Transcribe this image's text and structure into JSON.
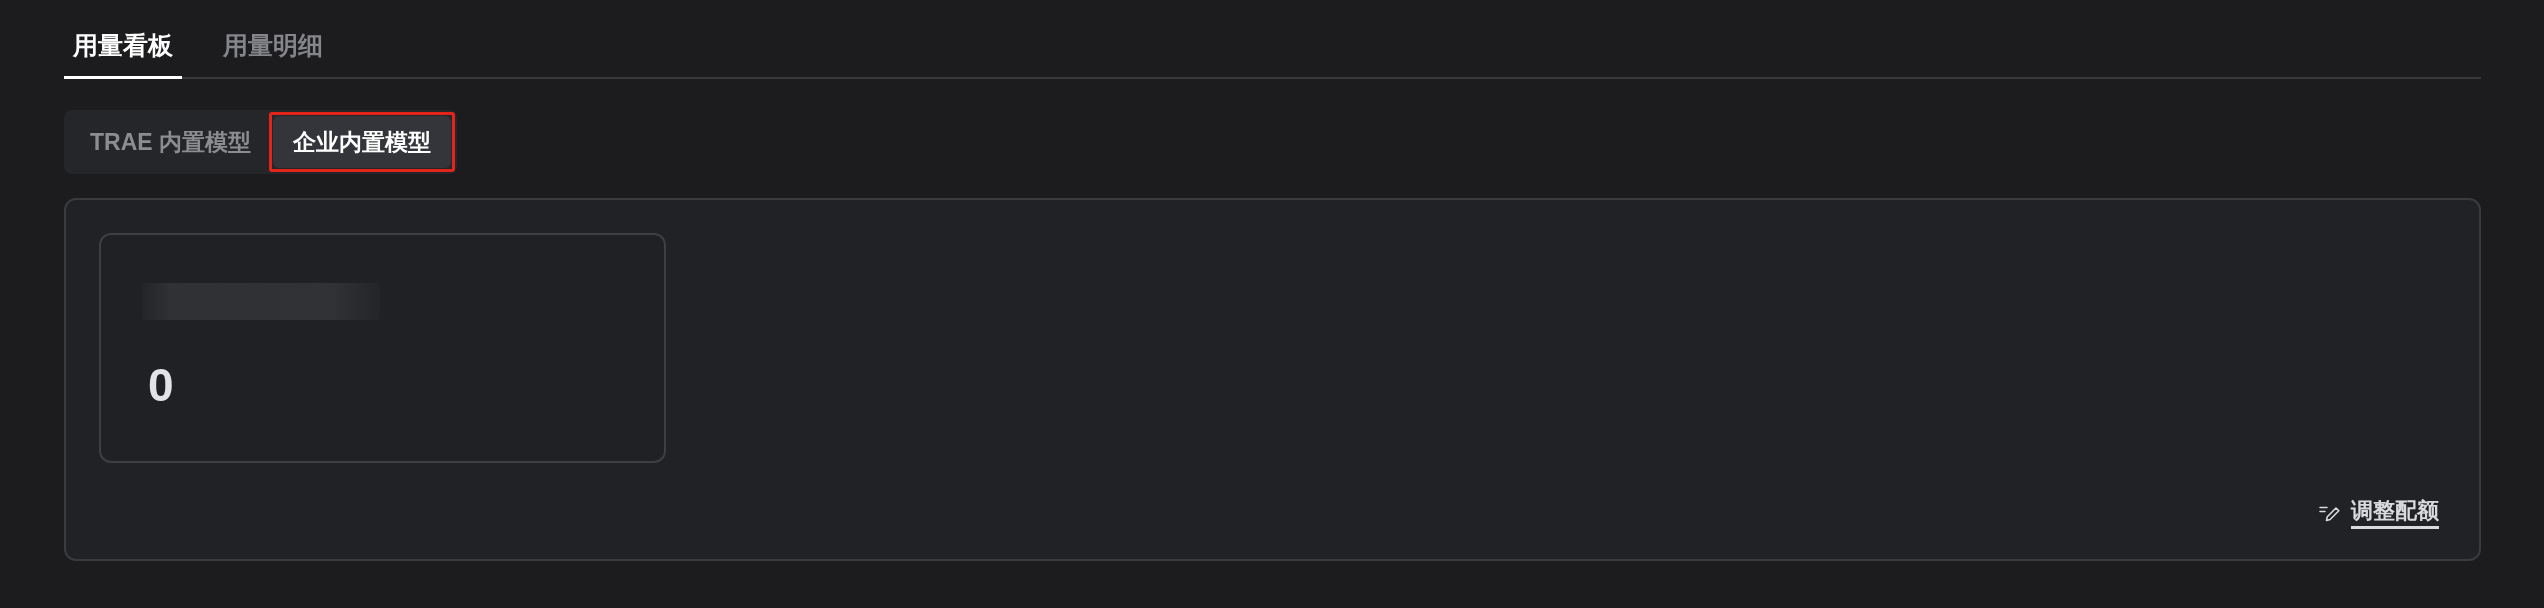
{
  "top_tabs": [
    {
      "label": "用量看板",
      "selected": true
    },
    {
      "label": "用量明细",
      "selected": false
    }
  ],
  "model_tabs": [
    {
      "label": "TRAE 内置模型",
      "selected": false,
      "highlighted": false
    },
    {
      "label": "企业内置模型",
      "selected": true,
      "highlighted": true
    }
  ],
  "stat_card": {
    "label_blurred": true,
    "value": "0"
  },
  "adjust_quota_link": {
    "label": "调整配额"
  }
}
